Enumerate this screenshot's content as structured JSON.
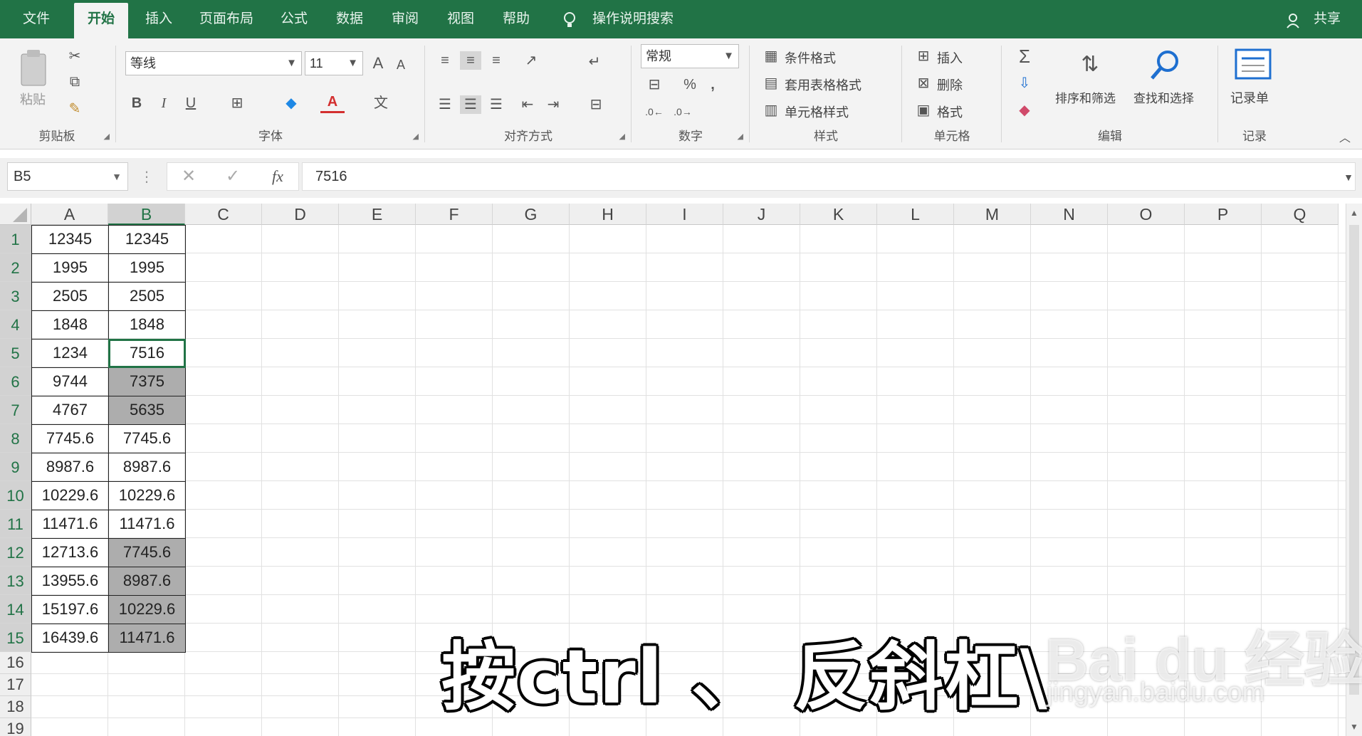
{
  "menu": {
    "tabs": [
      "文件",
      "开始",
      "插入",
      "页面布局",
      "公式",
      "数据",
      "审阅",
      "视图",
      "帮助"
    ],
    "active_tab": "开始",
    "tell_me": "操作说明搜索",
    "share": "共享"
  },
  "ribbon": {
    "clipboard": {
      "label": "剪贴板",
      "paste": "粘贴"
    },
    "font": {
      "label": "字体",
      "font_name": "等线",
      "font_size": "11",
      "bold": "B",
      "italic": "I",
      "underline": "U"
    },
    "alignment": {
      "label": "对齐方式"
    },
    "number": {
      "label": "数字",
      "format": "常规",
      "percent": "%",
      "comma": ","
    },
    "styles": {
      "label": "样式",
      "conditional": "条件格式",
      "table": "套用表格格式",
      "cell_styles": "单元格样式"
    },
    "cells": {
      "label": "单元格",
      "insert": "插入",
      "delete": "删除",
      "format": "格式"
    },
    "editing": {
      "label": "编辑",
      "sort_filter": "排序和筛选",
      "find_select": "查找和选择"
    },
    "record": {
      "label": "记录",
      "form": "记录单"
    }
  },
  "formula_bar": {
    "name_box": "B5",
    "formula": "7516",
    "fx": "fx"
  },
  "columns": [
    "A",
    "B",
    "C",
    "D",
    "E",
    "F",
    "G",
    "H",
    "I",
    "J",
    "K",
    "L",
    "M",
    "N",
    "O",
    "P",
    "Q"
  ],
  "rows": [
    "1",
    "2",
    "3",
    "4",
    "5",
    "6",
    "7",
    "8",
    "9",
    "10",
    "11",
    "12",
    "13",
    "14",
    "15",
    "16",
    "17",
    "18",
    "19"
  ],
  "cells": {
    "A": [
      "12345",
      "1995",
      "2505",
      "1848",
      "1234",
      "9744",
      "4767",
      "7745.6",
      "8987.6",
      "10229.6",
      "11471.6",
      "12713.6",
      "13955.6",
      "15197.6",
      "16439.6"
    ],
    "B": [
      "12345",
      "1995",
      "2505",
      "1848",
      "7516",
      "7375",
      "5635",
      "7745.6",
      "8987.6",
      "10229.6",
      "11471.6",
      "7745.6",
      "8987.6",
      "10229.6",
      "11471.6"
    ]
  },
  "highlighted_B_rows": [
    6,
    7,
    12,
    13,
    14,
    15
  ],
  "active_cell": "B5",
  "caption": "按ctrl 、 反斜杠\\",
  "watermark": {
    "brand": "Bai du 经验",
    "url": "jingyan.baidu.com"
  }
}
